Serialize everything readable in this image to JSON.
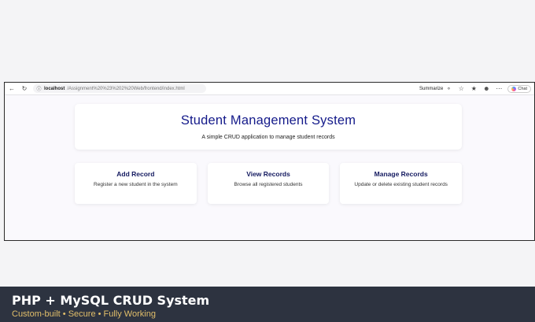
{
  "browser": {
    "address_host": "localhost",
    "address_path": "/Assignment%20%23%202%20Web/frontend/index.html",
    "summarize_label": "Summarize",
    "chat_label": "Chat"
  },
  "header": {
    "title": "Student Management System",
    "subtitle": "A simple CRUD application to manage student records"
  },
  "cards": [
    {
      "title": "Add Record",
      "description": "Register a new student in the system"
    },
    {
      "title": "View Records",
      "description": "Browse all registered students"
    },
    {
      "title": "Manage Records",
      "description": "Update or delete existing student records"
    }
  ],
  "banner": {
    "title": "PHP + MySQL CRUD System",
    "subtitle": "Custom-built • Secure • Fully Working"
  },
  "colors": {
    "title": "#141a8a",
    "banner_bg": "#2d3340",
    "banner_subtitle": "#e2bf6a"
  },
  "icons": [
    "back-icon",
    "refresh-icon",
    "info-icon",
    "star-icon",
    "favorites-icon",
    "profile-icon",
    "more-icon",
    "copilot-icon"
  ]
}
